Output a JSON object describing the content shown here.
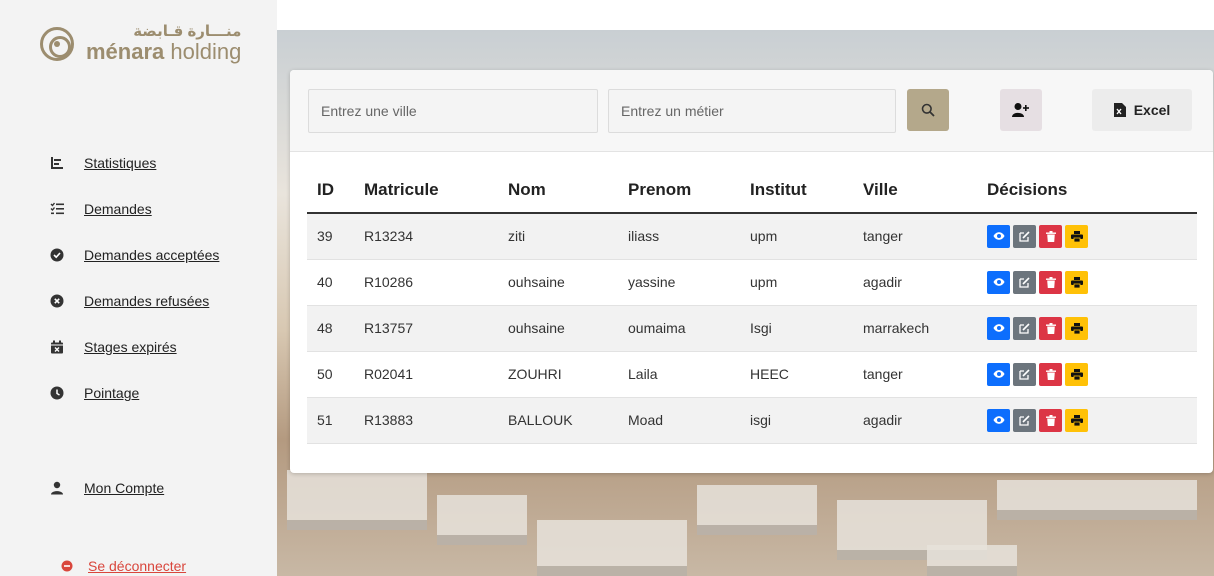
{
  "brand": {
    "name_ar": "منـــارة قـابضة",
    "name_bold": "ménara",
    "name_rest": " holding"
  },
  "nav": {
    "items": [
      {
        "label": "Statistiques",
        "icon": "chart-bar-icon"
      },
      {
        "label": "Demandes",
        "icon": "list-check-icon"
      },
      {
        "label": "Demandes acceptées",
        "icon": "circle-check-icon"
      },
      {
        "label": "Demandes refusées",
        "icon": "circle-x-icon"
      },
      {
        "label": "Stages expirés",
        "icon": "calendar-x-icon"
      },
      {
        "label": "Pointage",
        "icon": "clock-icon"
      }
    ],
    "account_label": "Mon Compte",
    "logout_label": "Se déconnecter"
  },
  "filters": {
    "city_placeholder": "Entrez une ville",
    "job_placeholder": "Entrez un métier",
    "excel_label": "Excel"
  },
  "table": {
    "headers": [
      "ID",
      "Matricule",
      "Nom",
      "Prenom",
      "Institut",
      "Ville",
      "Décisions"
    ],
    "rows": [
      {
        "id": "39",
        "matricule": "R13234",
        "nom": "ziti",
        "prenom": "iliass",
        "institut": "upm",
        "ville": "tanger"
      },
      {
        "id": "40",
        "matricule": "R10286",
        "nom": "ouhsaine",
        "prenom": "yassine",
        "institut": "upm",
        "ville": "agadir"
      },
      {
        "id": "48",
        "matricule": "R13757",
        "nom": "ouhsaine",
        "prenom": "oumaima",
        "institut": "Isgi",
        "ville": "marrakech"
      },
      {
        "id": "50",
        "matricule": "R02041",
        "nom": "ZOUHRI",
        "prenom": "Laila",
        "institut": "HEEC",
        "ville": "tanger"
      },
      {
        "id": "51",
        "matricule": "R13883",
        "nom": "BALLOUK",
        "prenom": "Moad",
        "institut": "isgi",
        "ville": "agadir"
      }
    ]
  },
  "colors": {
    "accent": "#b4a88b",
    "view": "#0d6efd",
    "edit": "#6c757d",
    "delete": "#dc3545",
    "print": "#ffc107",
    "logout": "#d9463c"
  }
}
